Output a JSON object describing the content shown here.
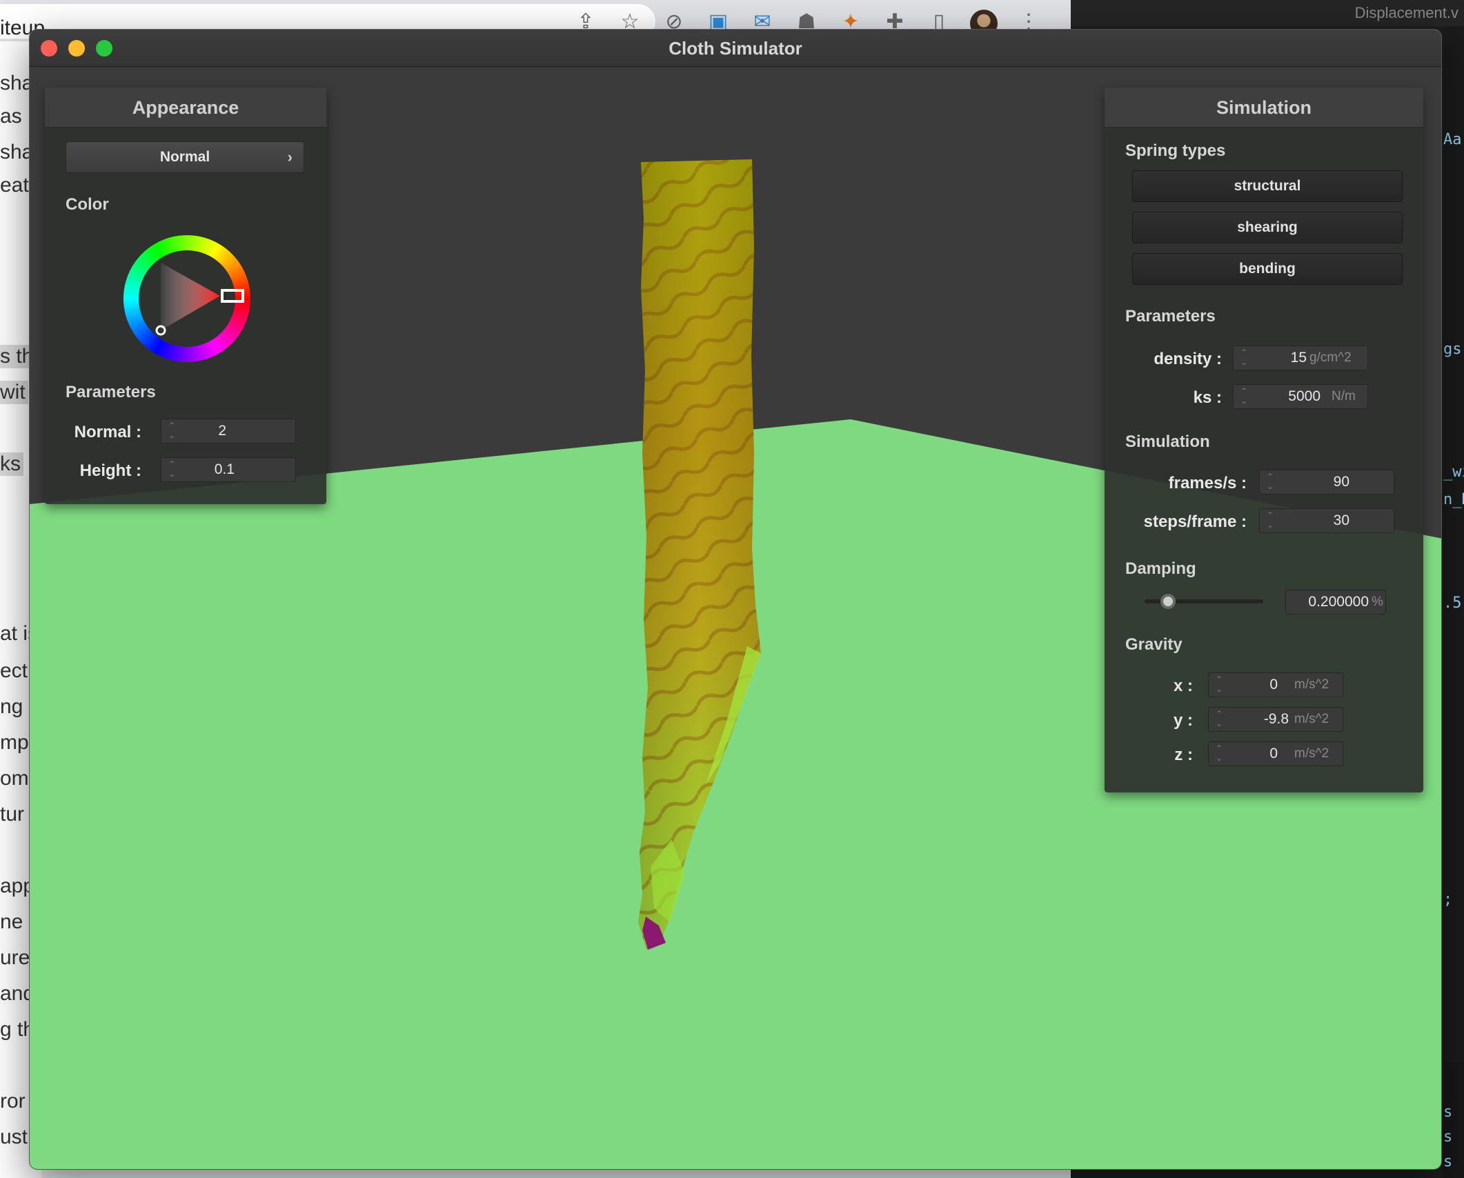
{
  "background": {
    "browser_tab_partial": "iteup",
    "editor_tab_partial": "Displacement.v",
    "doc_fragments": [
      "sha",
      "as",
      "sha",
      "eat",
      "s th",
      "wit",
      "ks",
      "at is",
      "ect",
      "ng",
      "mp",
      "omp",
      "tur",
      "app",
      "ne s",
      "ure",
      "and",
      "g th",
      "ror",
      "ust"
    ],
    "editor_fragments": [
      "Aa",
      "gs.",
      "_wi",
      "n_H",
      ".5",
      ";",
      "s",
      "s",
      "s"
    ]
  },
  "window": {
    "title": "Cloth Simulator"
  },
  "appearance": {
    "title": "Appearance",
    "shader_select": "Normal",
    "color_label": "Color",
    "params_label": "Parameters",
    "normal_label": "Normal :",
    "normal_value": "2",
    "height_label": "Height :",
    "height_value": "0.1",
    "colors": {
      "selected_hue": "#ff0000"
    }
  },
  "simulation": {
    "title": "Simulation",
    "spring_types_label": "Spring types",
    "springs": [
      "structural",
      "shearing",
      "bending"
    ],
    "params_label": "Parameters",
    "density_label": "density :",
    "density_value": "15",
    "density_unit": "g/cm^2",
    "ks_label": "ks :",
    "ks_value": "5000",
    "ks_unit": "N/m",
    "sim_label": "Simulation",
    "fps_label": "frames/s :",
    "fps_value": "90",
    "steps_label": "steps/frame :",
    "steps_value": "30",
    "damping_label": "Damping",
    "damping_value": "0.200000",
    "damping_unit": "%",
    "damping_fraction": 0.2,
    "gravity_label": "Gravity",
    "gx_label": "x :",
    "gx_value": "0",
    "gy_label": "y :",
    "gy_value": "-9.8",
    "gz_label": "z :",
    "gz_value": "0",
    "gravity_unit": "m/s^2"
  }
}
